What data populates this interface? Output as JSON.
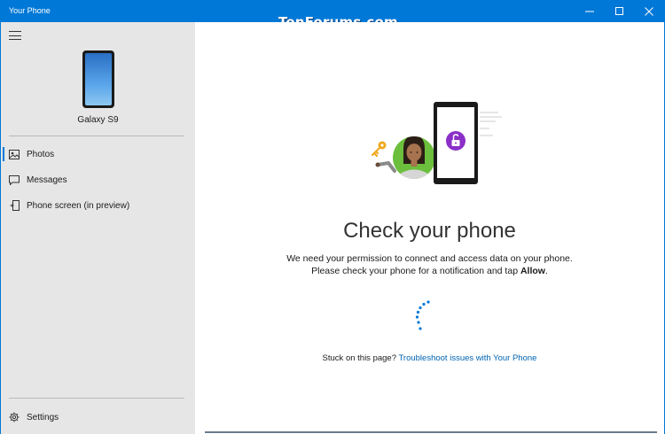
{
  "window": {
    "title": "Your Phone",
    "watermark": "TenForums.com",
    "accent_color": "#0078d7"
  },
  "sidebar": {
    "device_name": "Galaxy S9",
    "nav": [
      {
        "label": "Photos",
        "icon": "photos-icon",
        "selected": true
      },
      {
        "label": "Messages",
        "icon": "messages-icon"
      },
      {
        "label": "Phone screen (in preview)",
        "icon": "phone-screen-icon"
      }
    ],
    "settings_label": "Settings"
  },
  "main": {
    "heading": "Check your phone",
    "desc_line1": "We need your permission to connect and access data on your phone.",
    "desc_line2_pre": "Please check your phone for a notification and tap ",
    "desc_line2_bold": "Allow",
    "desc_line2_post": ".",
    "stuck_text": "Stuck on this page? ",
    "troubleshoot_link": "Troubleshoot issues with Your Phone",
    "link_color": "#0063b1",
    "illustration_icons": [
      "key-icon",
      "person-avatar-icon",
      "phone-lock-icon"
    ],
    "loading": true
  }
}
